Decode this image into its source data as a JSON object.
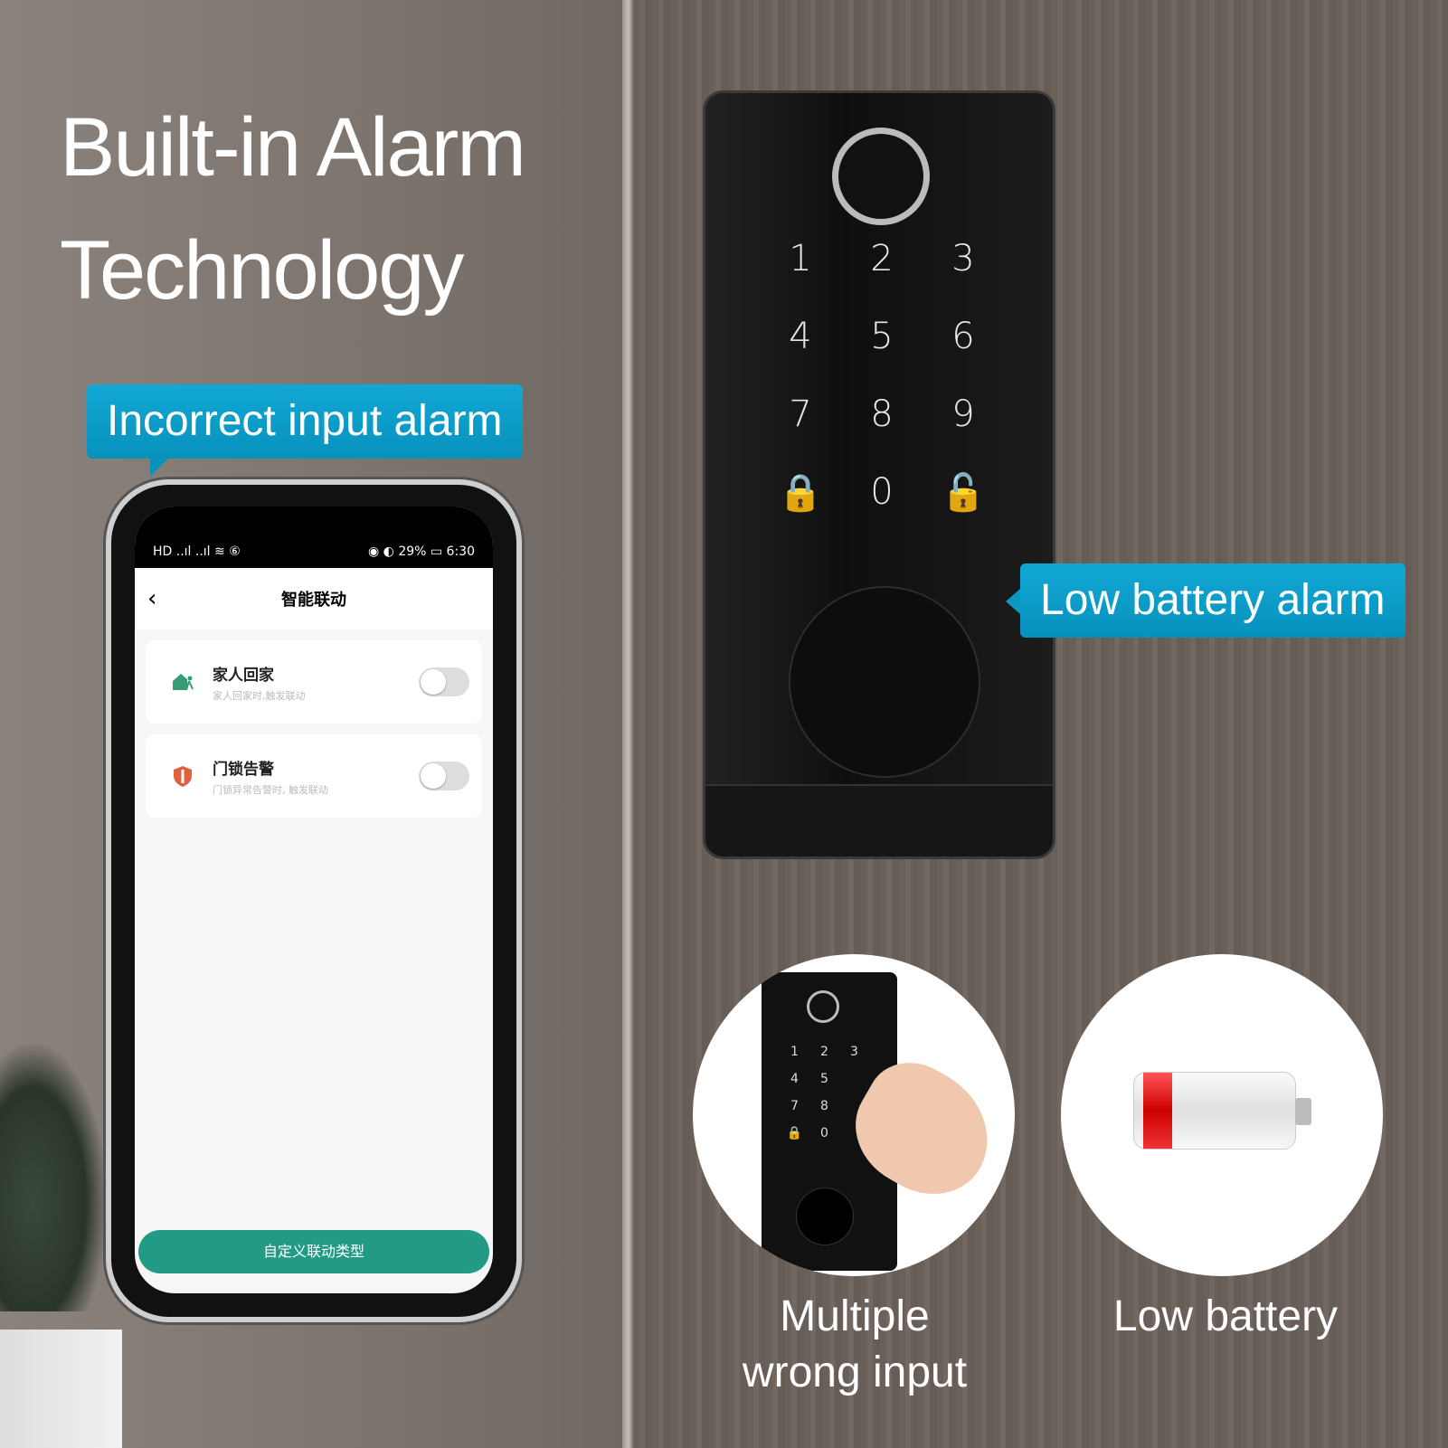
{
  "headline": {
    "line1": "Built-in Alarm",
    "line2": "Technology"
  },
  "callouts": {
    "incorrect_input": "Incorrect input alarm",
    "low_battery": "Low battery alarm"
  },
  "phone": {
    "status_left": "HD ..ıl ..ıl ≋ ⑥",
    "status_right": "◉ ◐ 29% ▭ 6:30",
    "back_icon": "‹",
    "screen_title": "智能联动",
    "items": [
      {
        "title": "家人回家",
        "subtitle": "家人回家时,触发联动",
        "icon": "home-person-icon",
        "icon_color": "#3a9a74",
        "enabled": false
      },
      {
        "title": "门锁告警",
        "subtitle": "门锁异常告警时, 触发联动",
        "icon": "shield-icon",
        "icon_color": "#e0613f",
        "enabled": false
      }
    ],
    "button_label": "自定义联动类型",
    "accent": "#229a86"
  },
  "lock": {
    "keys": [
      "1",
      "2",
      "3",
      "4",
      "5",
      "6",
      "7",
      "8",
      "9",
      "🔒",
      "0",
      "🔓"
    ]
  },
  "mini_lock": {
    "keys": [
      "1",
      "2",
      "3",
      "4",
      "5",
      "",
      "7",
      "8",
      "",
      "🔒",
      "0",
      ""
    ]
  },
  "captions": {
    "wrong_input": "Multiple\nwrong input",
    "low_battery": "Low battery"
  },
  "colors": {
    "callout": "#0a9ac6"
  }
}
